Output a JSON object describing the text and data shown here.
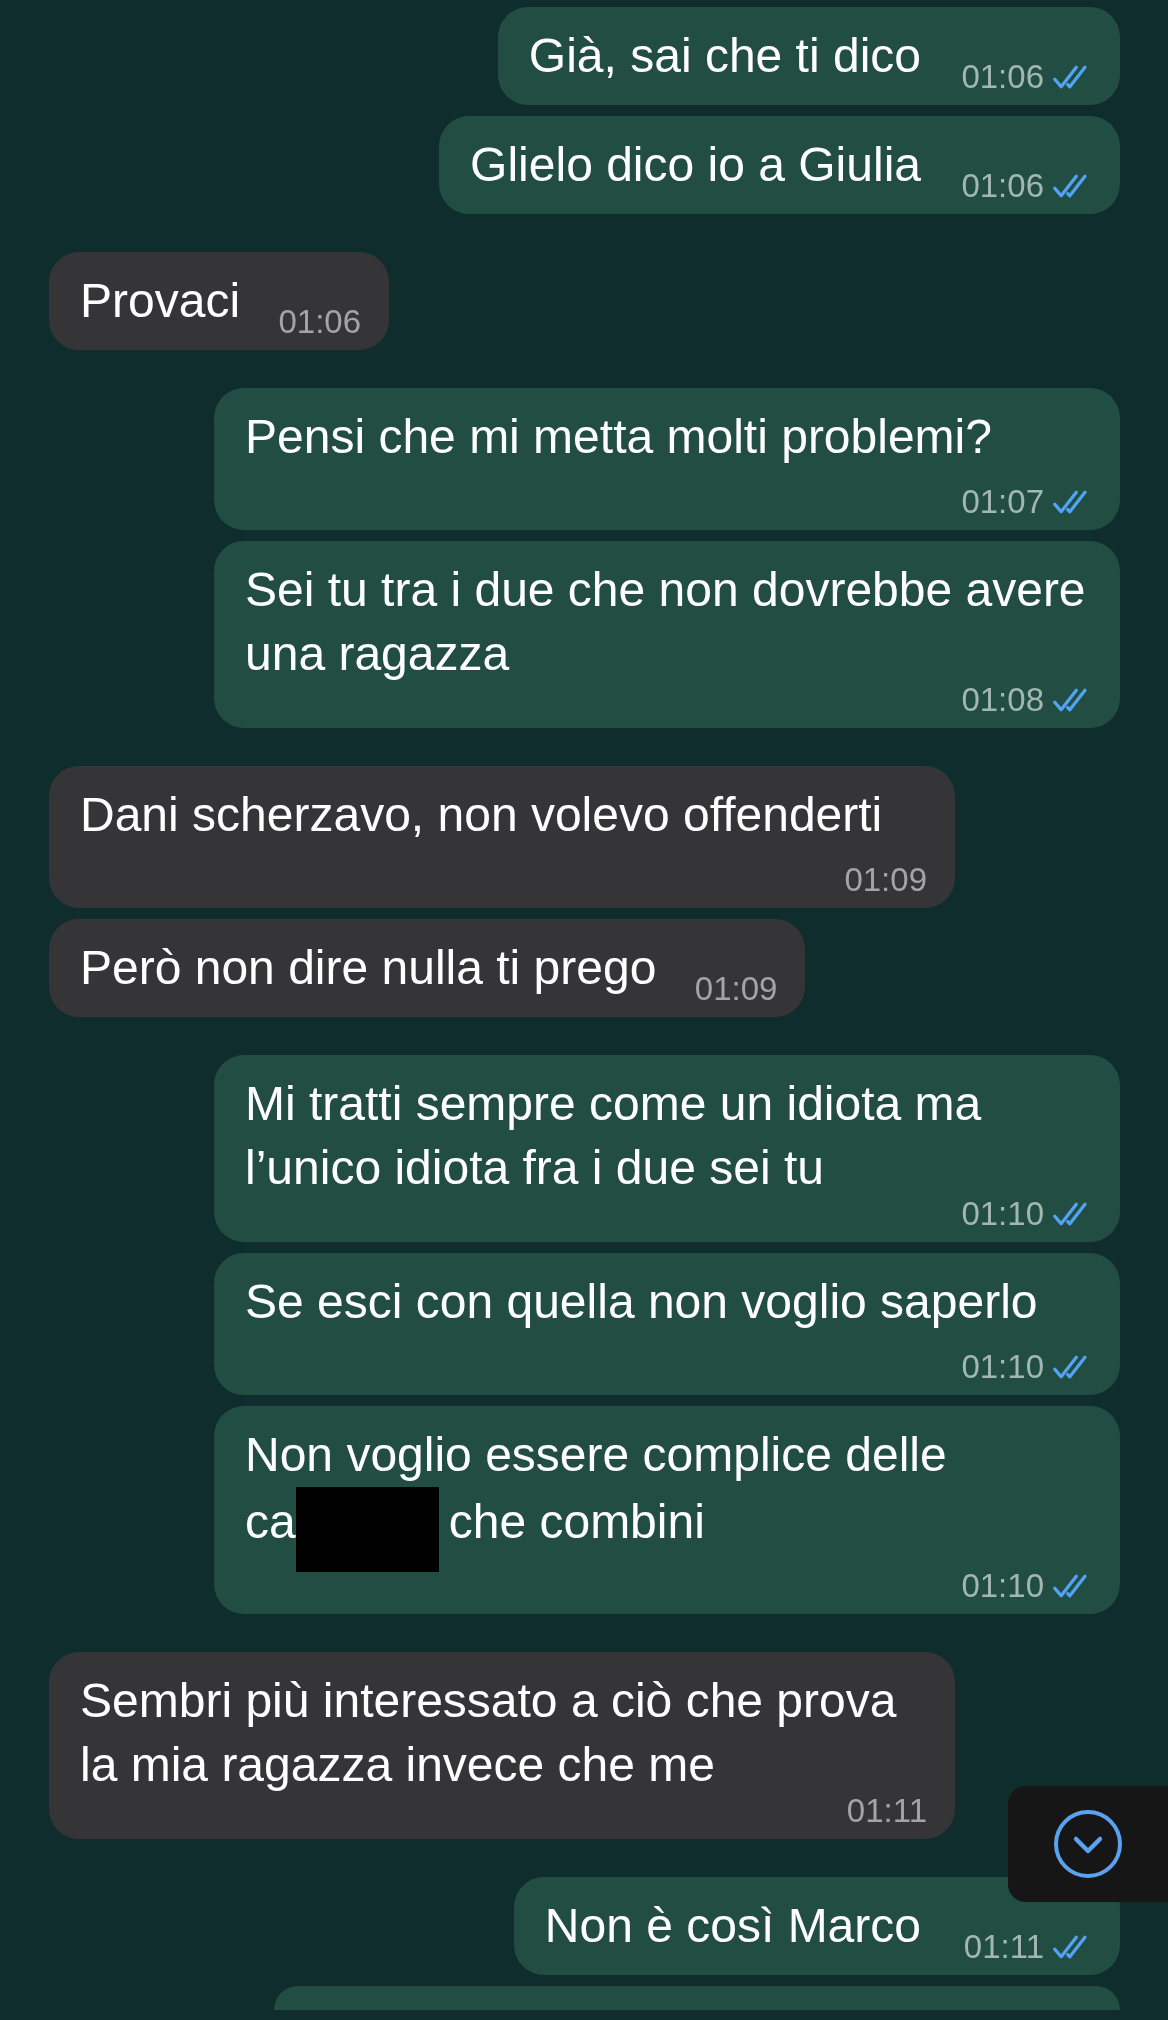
{
  "messages": [
    {
      "outgoing": true,
      "kind": "text",
      "text": "Già, sai che ti dico",
      "time": "01:06",
      "read": true
    },
    {
      "outgoing": true,
      "kind": "text",
      "text": "Glielo dico io a Giulia",
      "time": "01:06",
      "read": true
    },
    {
      "outgoing": false,
      "kind": "text",
      "text": "Provaci",
      "time": "01:06"
    },
    {
      "outgoing": true,
      "kind": "text",
      "text": "Pensi che mi metta molti problemi?",
      "time": "01:07",
      "read": true
    },
    {
      "outgoing": true,
      "kind": "text",
      "text": "Sei tu tra i due che non dovrebbe avere una ragazza",
      "time": "01:08",
      "read": true
    },
    {
      "outgoing": false,
      "kind": "text",
      "text": "Dani scherzavo, non volevo offenderti",
      "time": "01:09"
    },
    {
      "outgoing": false,
      "kind": "text",
      "text": "Però non dire nulla ti prego",
      "time": "01:09"
    },
    {
      "outgoing": true,
      "kind": "text",
      "text": "Mi tratti sempre come un idiota ma l’unico idiota fra i due sei tu",
      "time": "01:10",
      "read": true
    },
    {
      "outgoing": true,
      "kind": "text",
      "text": "Se esci con quella non voglio saperlo",
      "time": "01:10",
      "read": true
    },
    {
      "outgoing": true,
      "kind": "redacted",
      "text_before": "Non voglio essere complice delle",
      "text_partial": "ca",
      "text_after": "che combini",
      "time": "01:10",
      "read": true
    },
    {
      "outgoing": false,
      "kind": "text",
      "text": "Sembri più interessato a ciò che prova la mia ragazza invece che me",
      "time": "01:11"
    },
    {
      "outgoing": true,
      "kind": "text",
      "text": "Non è così Marco",
      "time": "01:11",
      "read": true
    },
    {
      "outgoing": true,
      "kind": "cut-off"
    }
  ],
  "scroll_down_button": {
    "visible": true
  }
}
